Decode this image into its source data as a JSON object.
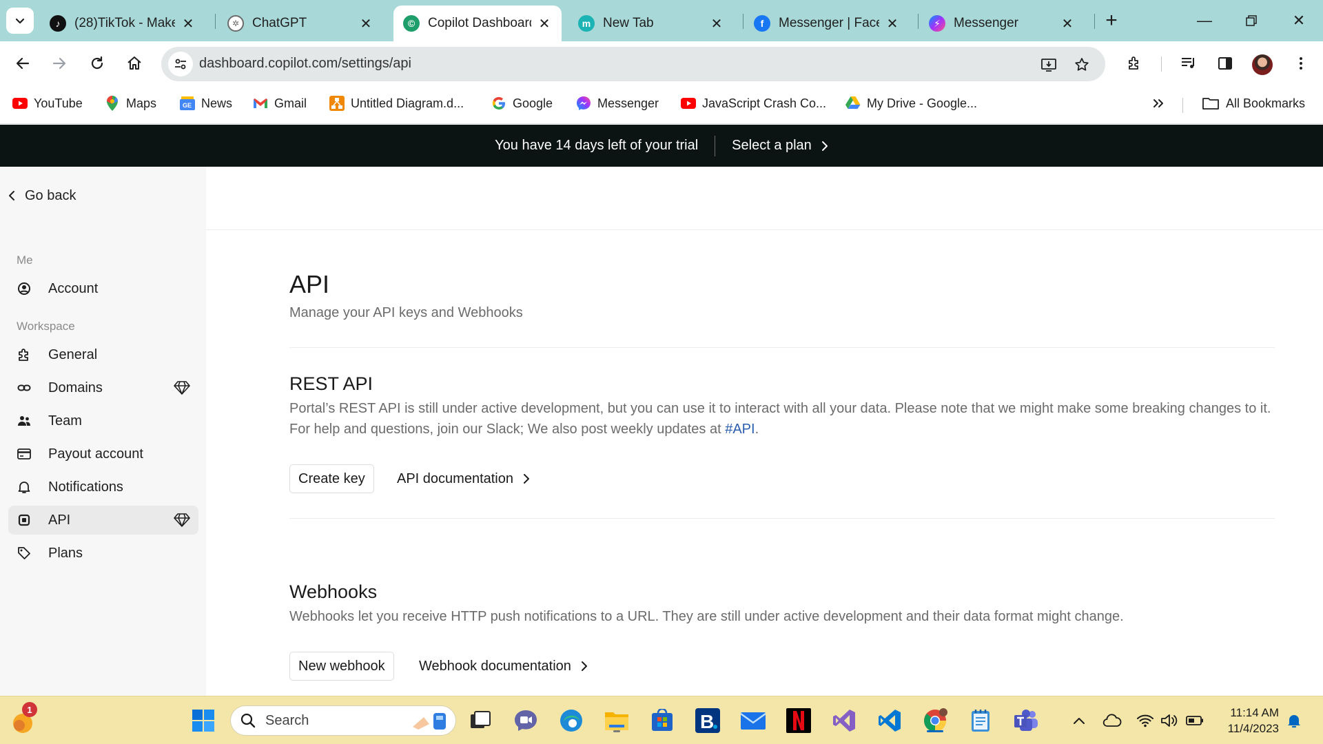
{
  "browser": {
    "tabs": [
      {
        "title": "(28)TikTok - Make",
        "icon": "tiktok-icon",
        "active": false
      },
      {
        "title": "ChatGPT",
        "icon": "chatgpt-icon",
        "active": false
      },
      {
        "title": "Copilot Dashboard",
        "icon": "copilot-icon",
        "active": true
      },
      {
        "title": "New Tab",
        "icon": "new-tab-icon",
        "active": false
      },
      {
        "title": "Messenger | Facebook",
        "icon": "facebook-icon",
        "active": false
      },
      {
        "title": "Messenger",
        "icon": "messenger-icon",
        "active": false
      }
    ],
    "url": "dashboard.copilot.com/settings/api",
    "bookmarks": [
      {
        "label": "YouTube",
        "icon": "youtube-icon"
      },
      {
        "label": "Maps",
        "icon": "maps-icon"
      },
      {
        "label": "News",
        "icon": "news-icon"
      },
      {
        "label": "Gmail",
        "icon": "gmail-icon"
      },
      {
        "label": "Untitled Diagram.d...",
        "icon": "drawio-icon"
      },
      {
        "label": "Google",
        "icon": "google-icon"
      },
      {
        "label": "Messenger",
        "icon": "messenger-icon"
      },
      {
        "label": "JavaScript Crash Co...",
        "icon": "youtube-icon"
      },
      {
        "label": "My Drive - Google...",
        "icon": "drive-icon"
      }
    ],
    "all_bookmarks_label": "All Bookmarks"
  },
  "banner": {
    "trial_text": "You have 14 days left of your trial",
    "plan_label": "Select a plan"
  },
  "sidebar": {
    "go_back": "Go back",
    "me_label": "Me",
    "me_items": [
      {
        "label": "Account",
        "icon": "user-circle-icon"
      }
    ],
    "workspace_label": "Workspace",
    "workspace_items": [
      {
        "label": "General",
        "icon": "puzzle-icon",
        "premium": false
      },
      {
        "label": "Domains",
        "icon": "link-icon",
        "premium": true
      },
      {
        "label": "Team",
        "icon": "team-icon",
        "premium": false
      },
      {
        "label": "Payout account",
        "icon": "card-icon",
        "premium": false
      },
      {
        "label": "Notifications",
        "icon": "bell-icon",
        "premium": false
      },
      {
        "label": "API",
        "icon": "chip-icon",
        "premium": true,
        "active": true
      },
      {
        "label": "Plans",
        "icon": "tag-icon",
        "premium": false
      }
    ]
  },
  "main": {
    "title": "API",
    "subtitle": "Manage your API keys and Webhooks",
    "rest": {
      "title": "REST API",
      "desc_1": "Portal’s REST API is still under active development, but you can use it to interact with all your data. Please note that we might make some breaking changes to it. For help and questions, join our Slack; We also post weekly updates at ",
      "desc_link": "#API",
      "desc_2": ".",
      "create_key": "Create key",
      "docs": "API documentation"
    },
    "webhooks": {
      "title": "Webhooks",
      "desc": "Webhooks let you receive HTTP push notifications to a URL. They are still under active development and their data format might change.",
      "new_webhook": "New webhook",
      "docs": "Webhook documentation"
    }
  },
  "taskbar": {
    "search_placeholder": "Search",
    "notification_count": "1",
    "time": "11:14 AM",
    "date": "11/4/2023"
  }
}
